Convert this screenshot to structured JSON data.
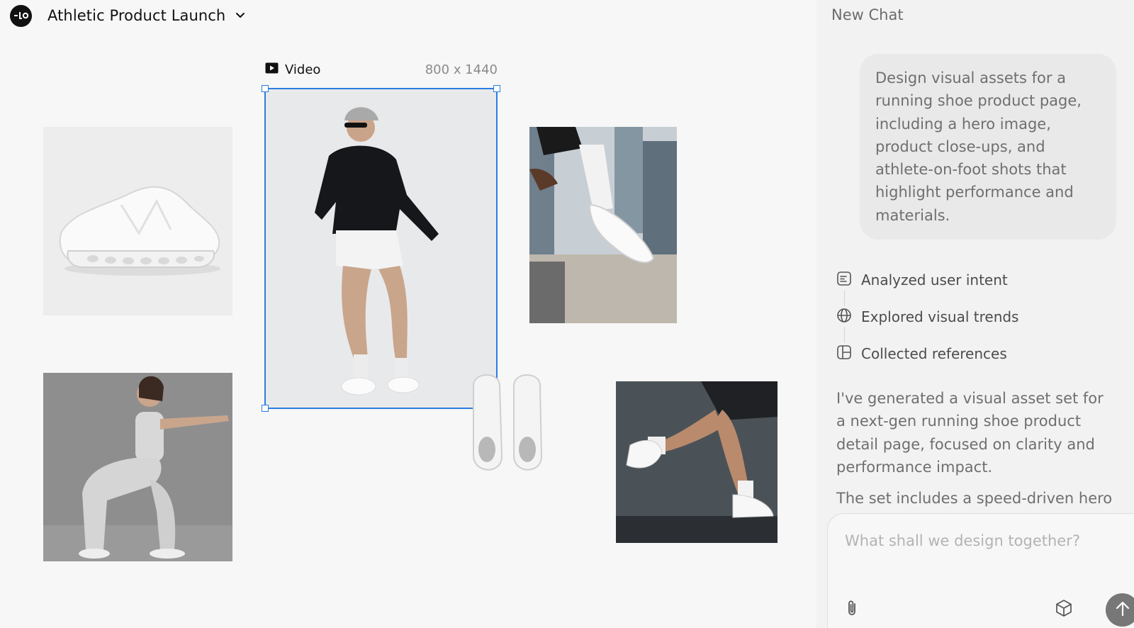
{
  "project": {
    "title": "Athletic Product Launch"
  },
  "canvas": {
    "selected_frame": {
      "type_label": "Video",
      "dimensions": "800 x 1440"
    }
  },
  "chat": {
    "title": "New Chat",
    "user_message": "Design visual assets for a running shoe product page, including a hero image, product close-ups, and athlete-on-foot shots that highlight performance and materials.",
    "steps": [
      {
        "icon": "document-lines-icon",
        "label": "Analyzed user intent"
      },
      {
        "icon": "globe-icon",
        "label": "Explored visual trends"
      },
      {
        "icon": "layout-grid-icon",
        "label": "Collected references"
      }
    ],
    "assistant_paragraphs": [
      "I've generated a visual asset set for a next-gen running shoe product detail page, focused on clarity and performance impact.",
      "The set includes a speed-driven hero"
    ],
    "composer": {
      "placeholder": "What shall we design together?"
    }
  },
  "colors": {
    "selection": "#2a7de1",
    "send_button": "#777777"
  }
}
